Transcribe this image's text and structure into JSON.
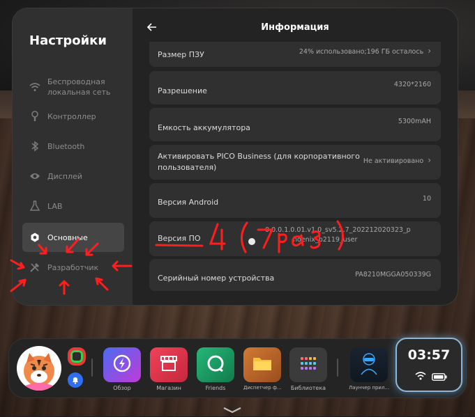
{
  "panel": {
    "sidebar_title": "Настройки",
    "menu": [
      {
        "icon": "wifi-icon",
        "label_line1": "Беспроводная",
        "label_line2": "локальная сеть"
      },
      {
        "icon": "controller-icon",
        "label": "Контроллер"
      },
      {
        "icon": "bluetooth-icon",
        "label": "Bluetooth"
      },
      {
        "icon": "eye-icon",
        "label": "Дисплей"
      },
      {
        "icon": "flask-icon",
        "label": "LAB"
      },
      {
        "icon": "settings-gear-icon",
        "label": "Основные",
        "active": true
      },
      {
        "icon": "tools-icon",
        "label": "Разработчик"
      }
    ],
    "header_title": "Информация",
    "rows": [
      {
        "label": "Размер ПЗУ",
        "value": "24% использовано;196 ГБ  осталось",
        "chevron": true
      },
      {
        "label": "Разрешение",
        "value": "4320*2160"
      },
      {
        "label": "Емкость аккумулятора",
        "value": "5300mAH"
      },
      {
        "label_line1": "Активировать PICO Business (для корпоративного",
        "label_line2": "пользователя)",
        "value": "Не активировано",
        "chevron": true
      },
      {
        "label": "Версия Android",
        "value": "10"
      },
      {
        "label": "Версия ПО",
        "value_line1": "0.0.0.1.0.01.v1.0_sv5.2.7_202212020323_p",
        "value_line2": "hoenix_b2119_user"
      },
      {
        "label": "Серийный номер устройства",
        "value": "PA8210MGGA050339G"
      }
    ]
  },
  "dock": {
    "apps": [
      {
        "name": "Обзор",
        "icon": "lightning-icon",
        "color": "#7b3fe4"
      },
      {
        "name": "Магазин",
        "icon": "store-icon",
        "color": "#e8374a"
      },
      {
        "name": "Friends",
        "icon": "friends-ring-icon",
        "color": "#1c9a64"
      },
      {
        "name": "Диспетчер ф...",
        "icon": "folder-icon",
        "color": "#b9652a"
      },
      {
        "name": "Библиотека",
        "icon": "grid-icon",
        "color": "#3e3e3e"
      },
      {
        "name": "Лаунчер прил...",
        "icon": "vr-launcher-icon",
        "color": "#1a2a3a"
      }
    ],
    "clock": "03:57"
  },
  "annotation": {
    "text": "4 (7 раз)",
    "color": "#ff1e1e"
  }
}
